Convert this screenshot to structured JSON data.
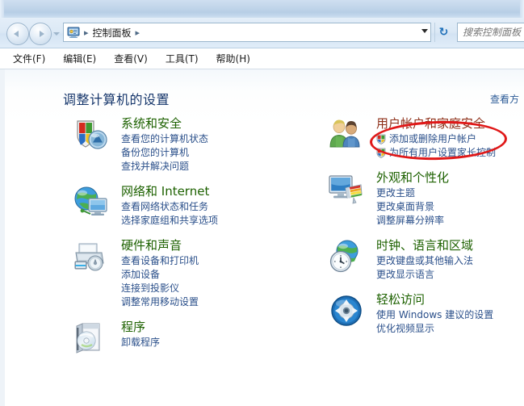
{
  "window": {
    "address_icon": "control-panel-icon"
  },
  "nav": {
    "back_label": "后退",
    "forward_label": "前进",
    "recent_pages_label": "最近浏览的页面",
    "refresh_label": "刷新",
    "refresh_glyph": "↻"
  },
  "breadcrumb": {
    "separator": "▸",
    "items": [
      {
        "label": "控制面板"
      }
    ],
    "trailing_separator": "▸"
  },
  "search": {
    "placeholder": "搜索控制面板",
    "value": ""
  },
  "menubar": {
    "items": [
      {
        "label": "文件(F)"
      },
      {
        "label": "编辑(E)"
      },
      {
        "label": "查看(V)"
      },
      {
        "label": "工具(T)"
      },
      {
        "label": "帮助(H)"
      }
    ]
  },
  "main": {
    "page_title": "调整计算机的设置",
    "view_by": "查看方式",
    "view_by_visible": "查看方"
  },
  "colors": {
    "category_title": "#1d6100",
    "link": "#2a4f8a",
    "page_title": "#16366b",
    "annotation": "#e01818",
    "highlighted_title": "#8d2f18"
  },
  "annotation": {
    "type": "red-ellipse",
    "targets": "用户帐户和家庭安全"
  },
  "categories_left": [
    {
      "title": "系统和安全",
      "icon": "shield-security-icon",
      "links": [
        {
          "label": "查看您的计算机状态",
          "shield": false
        },
        {
          "label": "备份您的计算机",
          "shield": false
        },
        {
          "label": "查找并解决问题",
          "shield": false
        }
      ]
    },
    {
      "title": "网络和 Internet",
      "icon": "globe-network-icon",
      "links": [
        {
          "label": "查看网络状态和任务",
          "shield": false
        },
        {
          "label": "选择家庭组和共享选项",
          "shield": false
        }
      ]
    },
    {
      "title": "硬件和声音",
      "icon": "printer-hardware-icon",
      "links": [
        {
          "label": "查看设备和打印机",
          "shield": false
        },
        {
          "label": "添加设备",
          "shield": false
        },
        {
          "label": "连接到投影仪",
          "shield": false
        },
        {
          "label": "调整常用移动设置",
          "shield": false
        }
      ]
    },
    {
      "title": "程序",
      "icon": "programs-cd-icon",
      "links": [
        {
          "label": "卸载程序",
          "shield": false
        }
      ]
    }
  ],
  "categories_right": [
    {
      "title": "用户帐户和家庭安全",
      "icon": "users-accounts-icon",
      "highlighted": true,
      "links": [
        {
          "label": "添加或删除用户帐户",
          "shield": true
        },
        {
          "label": "为所有用户设置家长控制",
          "shield": true
        }
      ]
    },
    {
      "title": "外观和个性化",
      "icon": "appearance-monitor-icon",
      "highlighted": false,
      "links": [
        {
          "label": "更改主题",
          "shield": false
        },
        {
          "label": "更改桌面背景",
          "shield": false
        },
        {
          "label": "调整屏幕分辨率",
          "shield": false
        }
      ]
    },
    {
      "title": "时钟、语言和区域",
      "icon": "clock-globe-icon",
      "highlighted": false,
      "links": [
        {
          "label": "更改键盘或其他输入法",
          "shield": false
        },
        {
          "label": "更改显示语言",
          "shield": false
        }
      ]
    },
    {
      "title": "轻松访问",
      "icon": "ease-of-access-icon",
      "highlighted": false,
      "links": [
        {
          "label": "使用 Windows 建议的设置",
          "shield": false
        },
        {
          "label": "优化视频显示",
          "shield": false
        }
      ]
    }
  ]
}
